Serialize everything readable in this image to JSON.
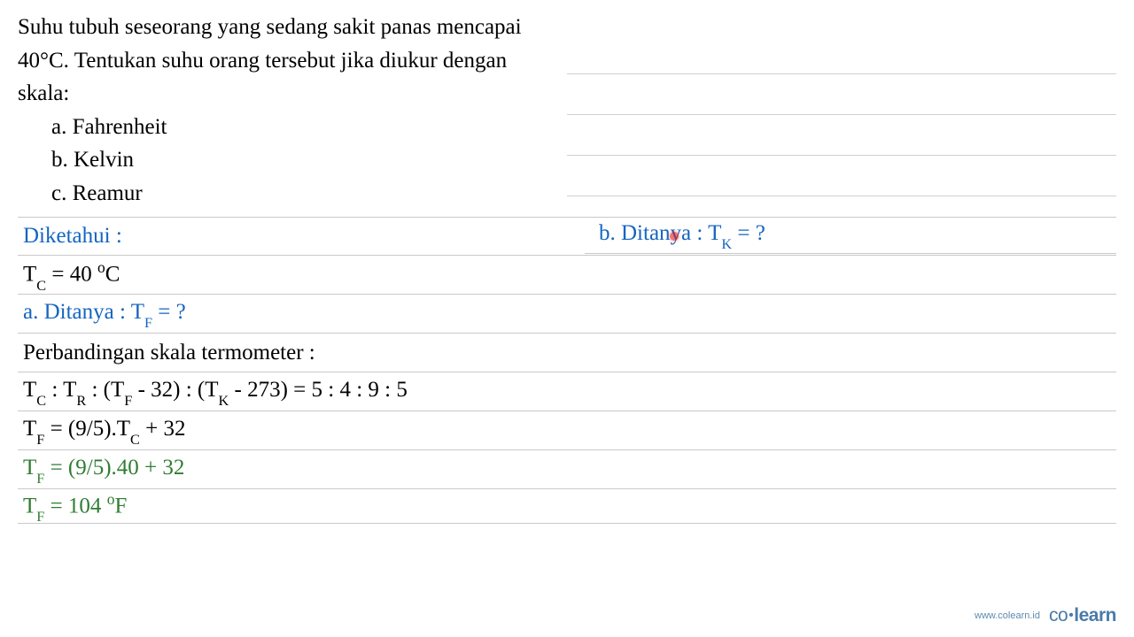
{
  "question": {
    "prompt": "Suhu tubuh seseorang yang sedang sakit panas mencapai 40°C. Tentukan suhu orang tersebut jika diukur dengan skala:",
    "options": {
      "a": "a.  Fahrenheit",
      "b": "b.  Kelvin",
      "c": "c.  Reamur"
    }
  },
  "work": {
    "diketahui_label": "Diketahui :",
    "tc_value": "T",
    "tc_sub": "C",
    "tc_eq": " = 40 ",
    "tc_unit_deg": "o",
    "tc_unit_c": "C",
    "a_ditanya": "a. Ditanya : T",
    "a_ditanya_sub": "F",
    "a_ditanya_q": " = ?",
    "ratio_label": "Perbandingan skala termometer :",
    "ratio_line_1": "T",
    "ratio_sub_c": "C",
    "ratio_colon1": " : T",
    "ratio_sub_r": "R",
    "ratio_colon2": " : (T",
    "ratio_sub_f": "F",
    "ratio_mid1": " - 32) : (T",
    "ratio_sub_k": "K",
    "ratio_mid2": " - 273) = 5 : 4 : 9 : 5",
    "tf_formula_1a": "T",
    "tf_formula_1b": "F",
    "tf_formula_1c": " = (9/5).T",
    "tf_formula_1d": "C",
    "tf_formula_1e": " + 32",
    "tf_calc_a": "T",
    "tf_calc_b": "F",
    "tf_calc_c": " = (9/5).40 + 32",
    "tf_result_a": "T",
    "tf_result_b": "F",
    "tf_result_c": " = 104 ",
    "tf_result_deg": "o",
    "tf_result_f": "F",
    "b_ditanya": "b. Ditanya : T",
    "b_ditanya_sub": "K",
    "b_ditanya_q": " = ?"
  },
  "footer": {
    "url": "www.colearn.id",
    "logo_co": "co",
    "logo_dot": "•",
    "logo_learn": "learn"
  }
}
